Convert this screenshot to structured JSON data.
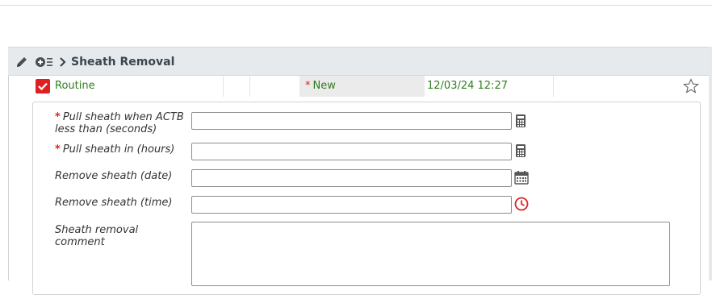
{
  "order": {
    "title": "Sheath Removal",
    "priority_label": "Routine",
    "status_label": "New",
    "datetime": "12/03/24 12:27"
  },
  "icons": {
    "edit": "pencil-icon",
    "add_to_list": "add-list-icon",
    "expand": "chevron-right-icon",
    "priority_checkbox": "checkbox-checked-icon",
    "favorite": "star-outline-icon",
    "calculator": "calculator-icon",
    "calendar": "calendar-icon",
    "clock": "clock-icon"
  },
  "form": {
    "fields": [
      {
        "label": "Pull sheath when ACTB less than (seconds)",
        "required": true,
        "value": ""
      },
      {
        "label": "Pull sheath in (hours)",
        "required": true,
        "value": ""
      },
      {
        "label": "Remove sheath (date)",
        "required": false,
        "value": ""
      },
      {
        "label": "Remove sheath (time)",
        "required": false,
        "value": ""
      },
      {
        "label": "Sheath removal comment",
        "required": false,
        "value": ""
      }
    ]
  },
  "colors": {
    "accent_green": "#2f7d1f",
    "required_red": "#d22222",
    "checkbox_red": "#e02020",
    "clock_red": "#d9262b",
    "header_bg": "#e7eaec"
  }
}
